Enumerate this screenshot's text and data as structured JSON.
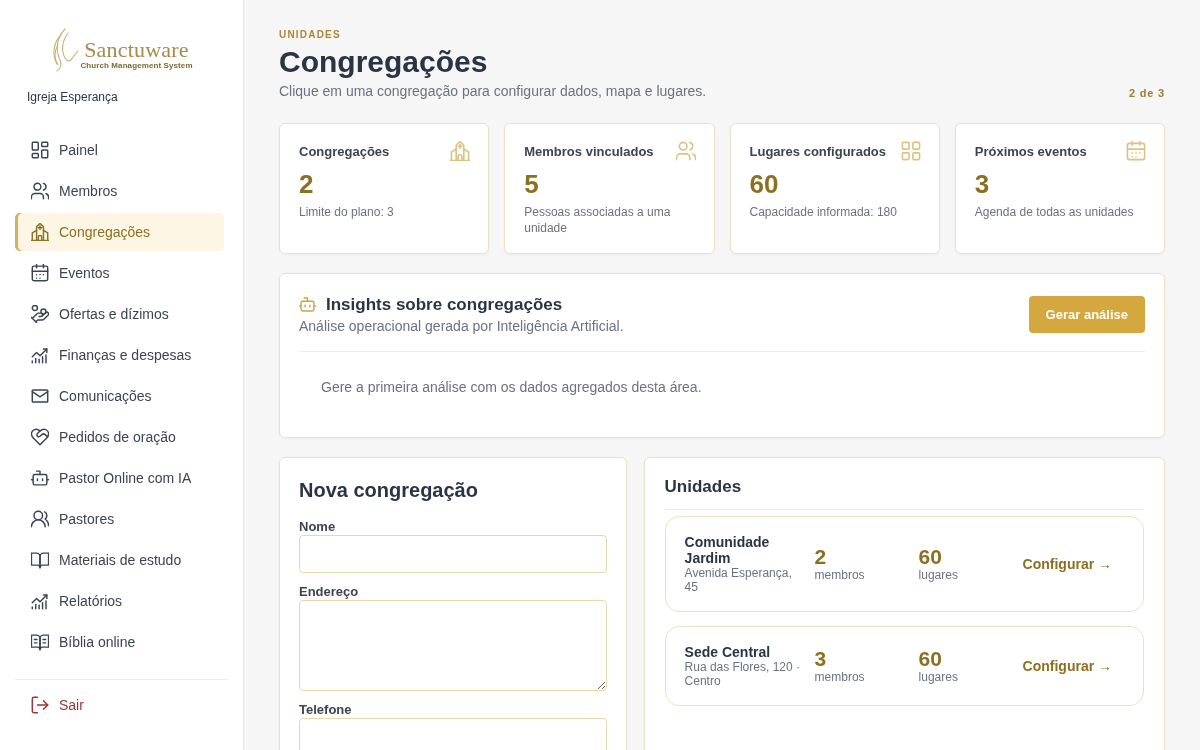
{
  "sidebar": {
    "logo": {
      "name": "Sanctuware",
      "tagline": "Church Management System"
    },
    "church_name": "Igreja Esperança",
    "nav": [
      {
        "label": "Painel",
        "selected": false
      },
      {
        "label": "Membros",
        "selected": false
      },
      {
        "label": "Congregações",
        "selected": true
      },
      {
        "label": "Eventos",
        "selected": false
      },
      {
        "label": "Ofertas e dízimos",
        "selected": false
      },
      {
        "label": "Finanças e despesas",
        "selected": false
      },
      {
        "label": "Comunicações",
        "selected": false
      },
      {
        "label": "Pedidos de oração",
        "selected": false
      },
      {
        "label": "Pastor Online com IA",
        "selected": false
      },
      {
        "label": "Pastores",
        "selected": false
      },
      {
        "label": "Materiais de estudo",
        "selected": false
      },
      {
        "label": "Relatórios",
        "selected": false
      },
      {
        "label": "Bíblia online",
        "selected": false
      }
    ],
    "logout": "Sair"
  },
  "header": {
    "eyebrow": "UNIDADES",
    "title": "Congregações",
    "subtitle": "Clique em uma congregação para configurar dados, mapa e lugares.",
    "counter": "2 de 3"
  },
  "stats": [
    {
      "label": "Congregações",
      "value": "2",
      "caption": "Limite do plano: 3"
    },
    {
      "label": "Membros vinculados",
      "value": "5",
      "caption": "Pessoas associadas a uma unidade"
    },
    {
      "label": "Lugares configurados",
      "value": "60",
      "caption": "Capacidade informada: 180"
    },
    {
      "label": "Próximos eventos",
      "value": "3",
      "caption": "Agenda de todas as unidades"
    }
  ],
  "insights": {
    "title": "Insights sobre congregações",
    "subtitle": "Análise operacional gerada por Inteligência Artificial.",
    "button": "Gerar análise",
    "empty_message": "Gere a primeira análise com os dados agregados desta área."
  },
  "new_congregation_form": {
    "title": "Nova congregação",
    "fields": [
      {
        "label": "Nome",
        "kind": "input"
      },
      {
        "label": "Endereço",
        "kind": "textarea"
      },
      {
        "label": "Telefone",
        "kind": "input"
      }
    ]
  },
  "units": {
    "title": "Unidades",
    "items": [
      {
        "name": "Comunidade Jardim",
        "address": "Avenida Esperança, 45",
        "members": "2",
        "members_label": "membros",
        "places": "60",
        "places_label": "lugares",
        "action": "Configurar →"
      },
      {
        "name": "Sede Central",
        "address": "Rua das Flores, 120 · Centro",
        "members": "3",
        "members_label": "membros",
        "places": "60",
        "places_label": "lugares",
        "action": "Configurar →"
      }
    ]
  }
}
